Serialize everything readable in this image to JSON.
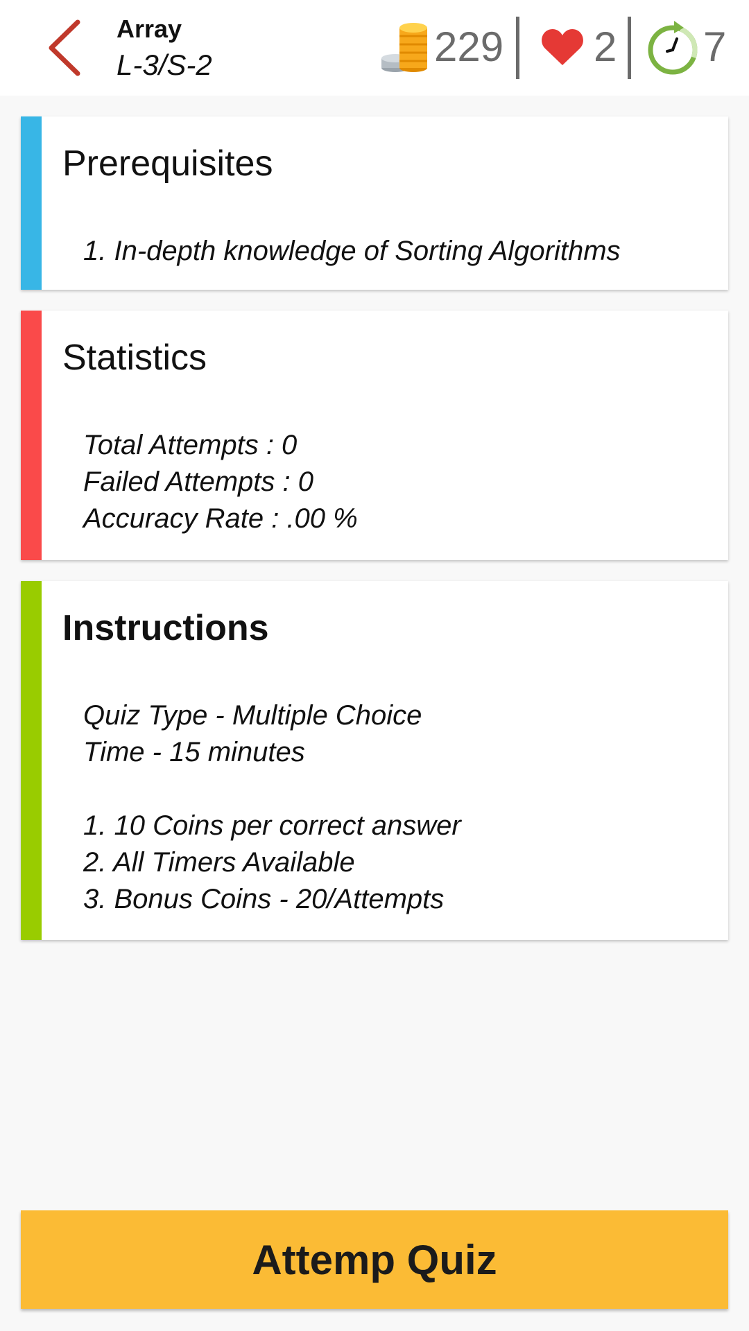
{
  "header": {
    "title": "Array",
    "subtitle": "L-3/S-2",
    "coins": "229",
    "lives": "2",
    "timers": "7",
    "icons": [
      "back-chevron-icon",
      "coins-icon",
      "heart-icon",
      "timer-icon"
    ]
  },
  "prerequisites": {
    "title": "Prerequisites",
    "items": [
      "1. In-depth knowledge of Sorting Algorithms"
    ],
    "accent": "#38b6e6"
  },
  "statistics": {
    "title": "Statistics",
    "lines": [
      "Total Attempts : 0",
      "Failed Attempts : 0",
      "Accuracy Rate : .00 %"
    ],
    "accent": "#fa4a4a"
  },
  "instructions": {
    "title": "Instructions",
    "lines": [
      "Quiz Type - Multiple Choice",
      "Time - 15 minutes",
      "1. 10 Coins per correct answer",
      "2. All Timers Available",
      "3. Bonus Coins - 20/Attempts"
    ],
    "accent": "#99cc00"
  },
  "cta": {
    "label": "Attemp Quiz",
    "color": "#fbbb35"
  }
}
